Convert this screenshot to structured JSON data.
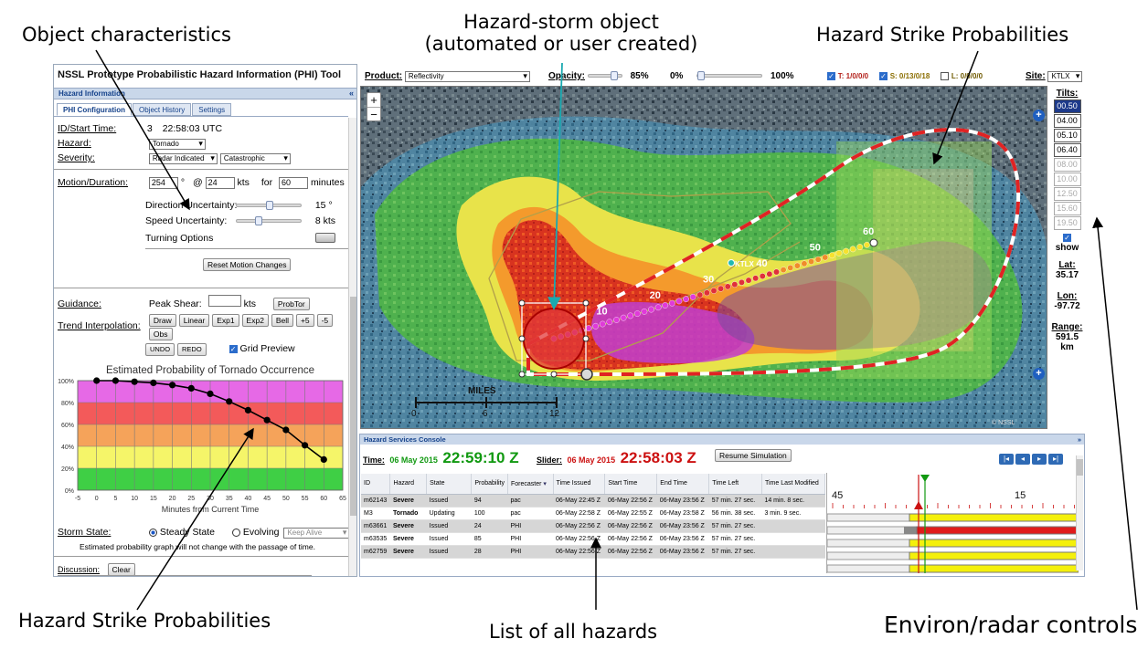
{
  "callouts": {
    "object_characteristics": "Object characteristics",
    "hazard_storm_line1": "Hazard-storm object",
    "hazard_storm_line2": "(automated or user created)",
    "strike_probs_top": "Hazard Strike Probabilities",
    "strike_probs_bottom": "Hazard Strike Probabilities",
    "list_all_hazards": "List of all hazards",
    "environ_controls": "Environ/radar controls"
  },
  "app": {
    "title": "NSSL Prototype Probabilistic Hazard Information (PHI) Tool",
    "panel_header": "Hazard Information",
    "collapse_icon": "«",
    "tabs": [
      "PHI Configuration",
      "Object History",
      "Settings"
    ]
  },
  "form": {
    "id_label": "ID/Start Time:",
    "id_value": "3",
    "start_time": "22:58:03 UTC",
    "hazard_label": "Hazard:",
    "hazard_value": "Tornado",
    "severity_label": "Severity:",
    "severity_value1": "Radar Indicated",
    "severity_value2": "Catastrophic",
    "motion_label": "Motion/Duration:",
    "motion_dir": "254",
    "deg_symbol": "°",
    "at_symbol": "@",
    "motion_speed": "24",
    "kts": "kts",
    "for": "for",
    "duration": "60",
    "minutes": "minutes",
    "dir_uncert_label": "Direction Uncertainty:",
    "dir_uncert_value": "15 °",
    "dir_uncert_level": 0.52,
    "speed_uncert_label": "Speed Uncertainty:",
    "speed_uncert_value": "8 kts",
    "speed_uncert_level": 0.33,
    "turning_label": "Turning Options",
    "reset_button": "Reset Motion Changes",
    "guidance_label": "Guidance:",
    "peak_shear_label": "Peak Shear:",
    "peak_shear_unit": "kts",
    "probtor_button": "ProbTor",
    "trend_label": "Trend Interpolation:",
    "trend_buttons": [
      "Draw",
      "Linear",
      "Exp1",
      "Exp2",
      "Bell",
      "+5",
      "-5",
      "Obs"
    ],
    "undo": "UNDO",
    "redo": "REDO",
    "grid_preview": "Grid Preview",
    "storm_state_label": "Storm State:",
    "steady_state": "Steady State",
    "evolving": "Evolving",
    "keep_alive": "Keep Alive",
    "note": "Estimated probability graph will not change with the passage of time.",
    "discussion_label": "Discussion:",
    "clear_button": "Clear"
  },
  "chart_data": {
    "type": "line",
    "title": "Estimated Probability of Tornado Occurrence",
    "xlabel": "Minutes from Current Time",
    "ylabel": "",
    "xlim": [
      -5,
      65
    ],
    "ylim": [
      0,
      100
    ],
    "xticks": [
      "-5",
      "0",
      "5",
      "10",
      "15",
      "20",
      "25",
      "30",
      "35",
      "40",
      "45",
      "50",
      "55",
      "60",
      "65"
    ],
    "yticks": [
      "0%",
      "20%",
      "40%",
      "60%",
      "80%",
      "100%"
    ],
    "bands": [
      {
        "from": 0,
        "to": 20,
        "color": "#3fcf45"
      },
      {
        "from": 20,
        "to": 40,
        "color": "#f5f569"
      },
      {
        "from": 40,
        "to": 60,
        "color": "#f5a35a"
      },
      {
        "from": 60,
        "to": 80,
        "color": "#f35a5a"
      },
      {
        "from": 80,
        "to": 100,
        "color": "#e669e6"
      }
    ],
    "series": [
      {
        "x": [
          0,
          5,
          10,
          15,
          20,
          25,
          30,
          35,
          40,
          45,
          50,
          55,
          60
        ],
        "values": [
          100,
          100,
          99,
          98,
          96,
          93,
          88,
          81,
          73,
          64,
          55,
          41,
          28
        ]
      }
    ],
    "grid": true
  },
  "toolbar": {
    "product_label": "Product:",
    "product_value": "Reflectivity",
    "opacity_label": "Opacity:",
    "opacity_value": "85%",
    "range_min": "0%",
    "range_max": "100%",
    "t_label": "T: 1/0/0/0",
    "s_label": "S: 0/13/0/18",
    "l_label": "L: 0/0/0/0",
    "site_label": "Site:",
    "site_value": "KTLX"
  },
  "map": {
    "zoom_in": "+",
    "zoom_out": "−",
    "miles_label": "MILES",
    "scale_ticks": [
      "0",
      "6",
      "12"
    ],
    "site_label": "KTLX",
    "track_labels": [
      "10",
      "20",
      "30",
      "40",
      "50",
      "60"
    ],
    "corner_text": "© NSSL"
  },
  "right_controls": {
    "tilts_label": "Tilts:",
    "tilts": [
      "00.50",
      "04.00",
      "05.10",
      "06.40",
      "08.00",
      "10.00",
      "12.50",
      "15.60",
      "19.50"
    ],
    "show_label": "show",
    "lat_label": "Lat:",
    "lat_value": "35.17",
    "lon_label": "Lon:",
    "lon_value": "-97.72",
    "range_label": "Range:",
    "range_value": "591.5",
    "range_unit": "km"
  },
  "console": {
    "header": "Hazard Services Console",
    "time_label": "Time:",
    "time_date": "06 May 2015",
    "time_value": "22:59:10 Z",
    "slider_label": "Slider:",
    "slider_date": "06 May 2015",
    "slider_value": "22:58:03 Z",
    "resume_button": "Resume Simulation",
    "nav_buttons": [
      "|◂",
      "◂",
      "▸",
      "▸|"
    ],
    "columns": [
      "ID",
      "Hazard",
      "State",
      "Probability",
      "Forecaster",
      "Time Issued",
      "Start Time",
      "End Time",
      "Time Left",
      "Time Last Modified"
    ],
    "rows": [
      {
        "id": "m62143",
        "hazard": "Severe",
        "state": "Issued",
        "prob": "94",
        "forecaster": "pac",
        "issued": "06-May 22:45 Z",
        "start": "06-May 22:56 Z",
        "end": "06-May 23:56 Z",
        "left": "57 min. 27 sec.",
        "modified": "14 min. 8 sec."
      },
      {
        "id": "M3",
        "hazard": "Tornado",
        "state": "Updating",
        "prob": "100",
        "forecaster": "pac",
        "issued": "06-May 22:58 Z",
        "start": "06-May 22:55 Z",
        "end": "06-May 23:58 Z",
        "left": "56 min. 38 sec.",
        "modified": "3 min. 9 sec."
      },
      {
        "id": "m63661",
        "hazard": "Severe",
        "state": "Issued",
        "prob": "24",
        "forecaster": "PHI",
        "issued": "06-May 22:56 Z",
        "start": "06-May 22:56 Z",
        "end": "06-May 23:56 Z",
        "left": "57 min. 27 sec.",
        "modified": ""
      },
      {
        "id": "m63535",
        "hazard": "Severe",
        "state": "Issued",
        "prob": "85",
        "forecaster": "PHI",
        "issued": "06-May 22:56 Z",
        "start": "06-May 22:56 Z",
        "end": "06-May 23:56 Z",
        "left": "57 min. 27 sec.",
        "modified": ""
      },
      {
        "id": "m62759",
        "hazard": "Severe",
        "state": "Issued",
        "prob": "28",
        "forecaster": "PHI",
        "issued": "06-May 22:56 Z",
        "start": "06-May 22:56 Z",
        "end": "06-May 23:56 Z",
        "left": "57 min. 27 sec.",
        "modified": ""
      }
    ],
    "timeline_labels": [
      "45",
      "15"
    ]
  }
}
